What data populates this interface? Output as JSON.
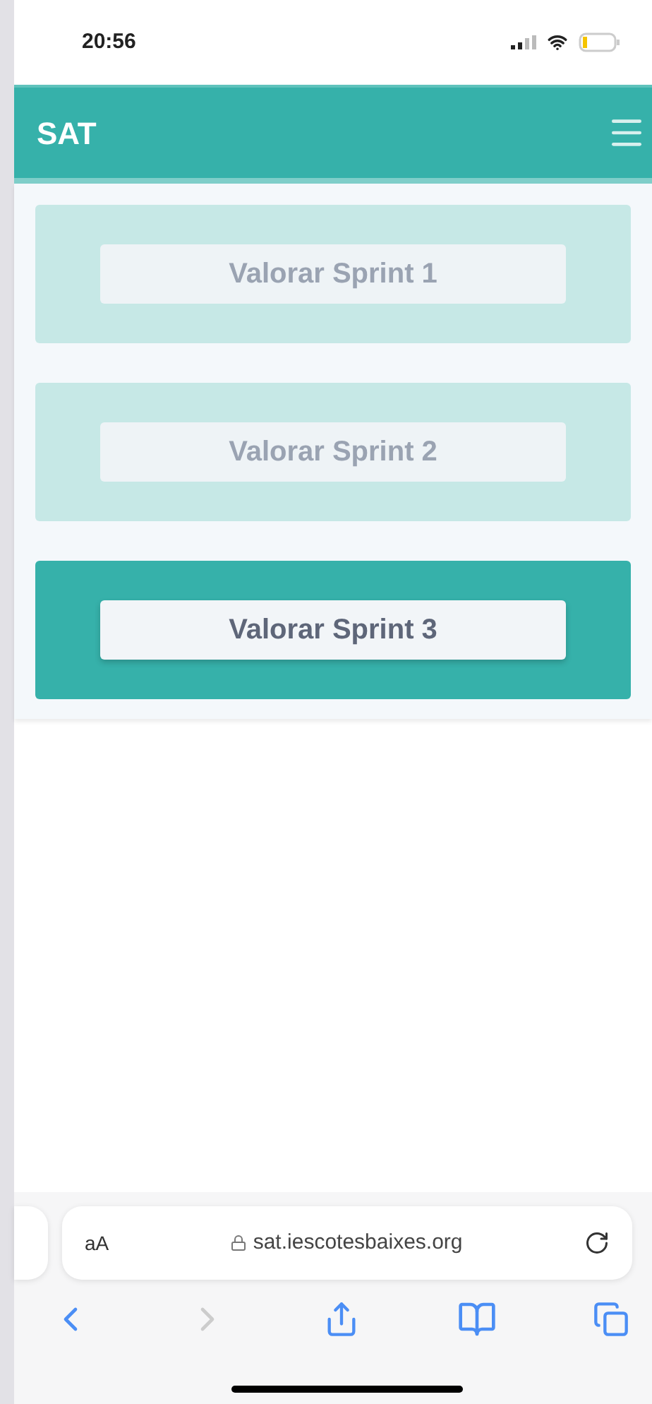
{
  "status_bar": {
    "time": "20:56"
  },
  "header": {
    "title": "SAT"
  },
  "sprints": [
    {
      "label": "Valorar Sprint 1",
      "disabled": true
    },
    {
      "label": "Valorar Sprint 2",
      "disabled": true
    },
    {
      "label": "Valorar Sprint 3",
      "disabled": false
    }
  ],
  "browser": {
    "text_size": "aA",
    "url": "sat.iescotesbaixes.org",
    "back_disabled": false,
    "forward_disabled": true
  }
}
